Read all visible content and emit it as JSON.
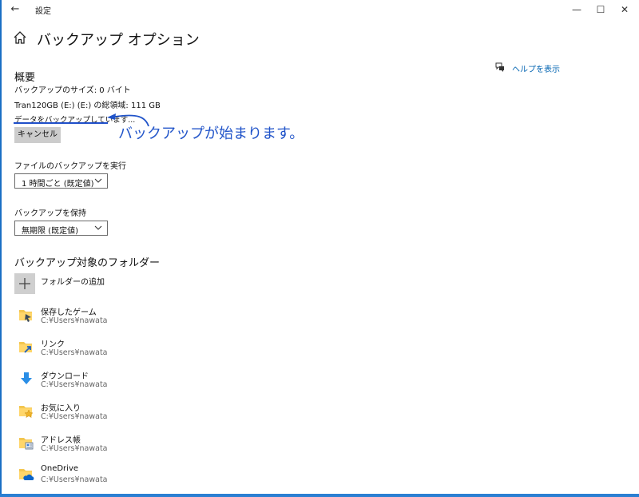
{
  "window": {
    "title": "設定",
    "back_glyph": "←",
    "minimize_glyph": "—",
    "maximize_glyph": "☐",
    "close_glyph": "✕"
  },
  "page": {
    "title": "バックアップ オプション"
  },
  "help": {
    "label": "ヘルプを表示",
    "color": "#0063b1"
  },
  "overview": {
    "heading": "概要",
    "backup_size": "バックアップのサイズ: 0 バイト",
    "drive_info": "Tran120GB (E:) (E:) の総領域: 111 GB",
    "status": "データをバックアップしています...",
    "cancel_label": "キャンセル"
  },
  "annotation": {
    "text": "バックアップが始まります。",
    "color": "#2154c9"
  },
  "backup_frequency": {
    "label": "ファイルのバックアップを実行",
    "value": "1 時間ごと (既定値)"
  },
  "keep_backups": {
    "label": "バックアップを保持",
    "value": "無期限 (既定値)"
  },
  "folders": {
    "heading": "バックアップ対象のフォルダー",
    "add_label": "フォルダーの追加",
    "items": [
      {
        "name": "保存したゲーム",
        "path": "C:¥Users¥nawata",
        "icon": "saved-games-folder-icon"
      },
      {
        "name": "リンク",
        "path": "C:¥Users¥nawata",
        "icon": "links-folder-icon"
      },
      {
        "name": "ダウンロード",
        "path": "C:¥Users¥nawata",
        "icon": "downloads-folder-icon"
      },
      {
        "name": "お気に入り",
        "path": "C:¥Users¥nawata",
        "icon": "favorites-folder-icon"
      },
      {
        "name": "アドレス帳",
        "path": "C:¥Users¥nawata",
        "icon": "contacts-folder-icon"
      },
      {
        "name": "OneDrive",
        "path": "C:¥Users¥nawata",
        "icon": "onedrive-folder-icon"
      }
    ]
  }
}
